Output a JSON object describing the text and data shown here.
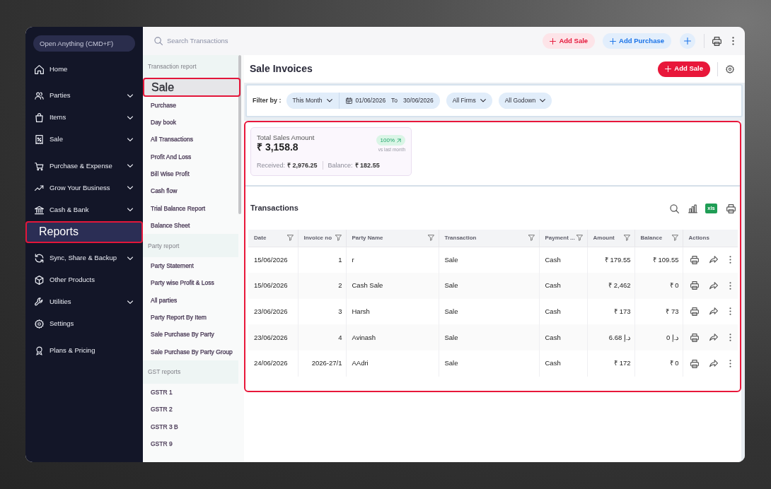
{
  "sidebar": {
    "search": {
      "placeholder": "Open Anything (CMD+F)"
    },
    "groups": [
      {
        "items": [
          {
            "label": "Home",
            "expandable": false,
            "selected": false
          }
        ]
      },
      {
        "items": [
          {
            "label": "Parties",
            "expandable": true,
            "selected": false
          },
          {
            "label": "Items",
            "expandable": true,
            "selected": false
          },
          {
            "label": "Sale",
            "expandable": true,
            "selected": false
          }
        ]
      },
      {
        "items": [
          {
            "label": "Purchase & Expense",
            "expandable": true,
            "selected": false
          },
          {
            "label": "Grow Your Business",
            "expandable": true,
            "selected": false
          },
          {
            "label": "Cash & Bank",
            "expandable": true,
            "selected": false
          },
          {
            "label": "Reports",
            "expandable": false,
            "selected": true
          }
        ]
      },
      {
        "items": [
          {
            "label": "Sync, Share & Backup",
            "expandable": true,
            "selected": false
          },
          {
            "label": "Other Products",
            "expandable": false,
            "selected": false
          },
          {
            "label": "Utilities",
            "expandable": true,
            "selected": false
          },
          {
            "label": "Settings",
            "expandable": false,
            "selected": false
          }
        ]
      },
      {
        "items": [
          {
            "label": "Plans & Pricing",
            "expandable": false,
            "selected": false
          }
        ]
      }
    ]
  },
  "top_bar": {
    "search": {
      "placeholder": "Search Transactions"
    },
    "buttons": [
      {
        "label": "Add Sale",
        "kind": "sale"
      },
      {
        "label": "Add Purchase",
        "kind": "purchase"
      }
    ]
  },
  "report_menu": {
    "sections": [
      {
        "title": "Transaction report",
        "items": [
          {
            "label": "Sale",
            "selected": true
          },
          {
            "label": "Purchase",
            "selected": false
          },
          {
            "label": "Day book",
            "selected": false
          },
          {
            "label": "All Transactions",
            "selected": false
          },
          {
            "label": "Profit And Loss",
            "selected": false
          },
          {
            "label": "Bill Wise Profit",
            "selected": false
          },
          {
            "label": "Cash flow",
            "selected": false
          },
          {
            "label": "Trial Balance Report",
            "selected": false
          },
          {
            "label": "Balance Sheet",
            "selected": false
          }
        ]
      },
      {
        "title": "Party report",
        "items": [
          {
            "label": "Party Statement",
            "selected": false
          },
          {
            "label": "Party wise Profit & Loss",
            "selected": false
          },
          {
            "label": "All parties",
            "selected": false
          },
          {
            "label": "Party Report By Item",
            "selected": false
          },
          {
            "label": "Sale Purchase By Party",
            "selected": false
          },
          {
            "label": "Sale Purchase By Party Group",
            "selected": false
          }
        ]
      },
      {
        "title": "GST reports",
        "items": [
          {
            "label": "GSTR 1",
            "selected": false
          },
          {
            "label": "GSTR 2",
            "selected": false
          },
          {
            "label": "GSTR 3 B",
            "selected": false
          },
          {
            "label": "GSTR 9",
            "selected": false
          }
        ]
      }
    ]
  },
  "page": {
    "title": "Sale Invoices",
    "add_button": {
      "label": "Add Sale"
    }
  },
  "filters": {
    "label": "Filter by :",
    "period": "This Month",
    "date_from": "01/06/2026",
    "date_joiner": "To",
    "date_to": "30/06/2026",
    "dropdowns": [
      {
        "label": "All Firms"
      },
      {
        "label": "All Godown"
      }
    ]
  },
  "results": {
    "highlighted": true,
    "summary": {
      "title": "Total Sales Amount",
      "total": "₹ 3,158.8",
      "change": "100%",
      "rising": true,
      "change_caption": "vs last month",
      "received_label": "Received:",
      "received": "₹ 2,976.25",
      "balance_label": "Balance:",
      "balance": "₹ 182.55"
    },
    "transactions": {
      "title": "Transactions",
      "export_label": "xls",
      "columns": [
        {
          "label": "Date",
          "kind": "text",
          "filterable": true
        },
        {
          "label": "Invoice no",
          "kind": "number",
          "filterable": true
        },
        {
          "label": "Party Name",
          "kind": "text",
          "filterable": true
        },
        {
          "label": "Transaction",
          "kind": "text",
          "filterable": true
        },
        {
          "label": "Payment ...",
          "kind": "text",
          "filterable": true
        },
        {
          "label": "Amount",
          "kind": "number",
          "filterable": true
        },
        {
          "label": "Balance",
          "kind": "number",
          "filterable": true
        },
        {
          "label": "Actions",
          "kind": "actions",
          "filterable": false
        }
      ],
      "rows": [
        [
          "15/06/2026",
          "1",
          "r",
          "Sale",
          "Cash",
          "₹ 179.55",
          "₹ 109.55"
        ],
        [
          "15/06/2026",
          "2",
          "Cash Sale",
          "Sale",
          "Cash",
          "₹ 2,462",
          "₹ 0"
        ],
        [
          "23/06/2026",
          "3",
          "Harsh",
          "Sale",
          "Cash",
          "₹ 173",
          "₹ 73"
        ],
        [
          "23/06/2026",
          "4",
          "Avinash",
          "Sale",
          "Cash",
          "6.68 د.إ",
          "0 د.إ"
        ],
        [
          "24/06/2026",
          "2026-27/1",
          "AAdri",
          "Sale",
          "Cash",
          "₹ 172",
          "₹ 0"
        ]
      ]
    }
  }
}
